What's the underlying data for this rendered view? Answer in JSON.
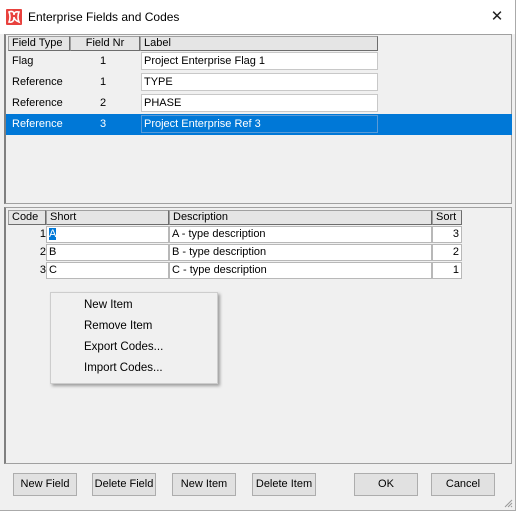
{
  "window": {
    "title": "Enterprise Fields and Codes",
    "icon": "app-logo-icon",
    "close_icon": "close-icon",
    "close_glyph": "✕"
  },
  "fields_table": {
    "columns": [
      "Field Type",
      "Field Nr",
      "Label"
    ],
    "rows": [
      {
        "type": "Flag",
        "nr": "1",
        "label": "Project Enterprise Flag 1",
        "selected": false
      },
      {
        "type": "Reference",
        "nr": "1",
        "label": "TYPE",
        "selected": false
      },
      {
        "type": "Reference",
        "nr": "2",
        "label": "PHASE",
        "selected": false
      },
      {
        "type": "Reference",
        "nr": "3",
        "label": "Project Enterprise Ref 3",
        "selected": true
      }
    ]
  },
  "codes_table": {
    "columns": [
      "Code",
      "Short",
      "Description",
      "Sort"
    ],
    "rows": [
      {
        "code": "1",
        "short": "A",
        "description": "A - type description",
        "sort": "3"
      },
      {
        "code": "2",
        "short": "B",
        "description": "B - type description",
        "sort": "2"
      },
      {
        "code": "3",
        "short": "C",
        "description": "C - type description",
        "sort": "1"
      }
    ]
  },
  "context_menu": {
    "items": [
      "New Item",
      "Remove Item",
      "Export Codes...",
      "Import Codes..."
    ]
  },
  "buttons": {
    "new_field": "New Field",
    "delete_field": "Delete Field",
    "new_item": "New Item",
    "delete_item": "Delete Item",
    "ok": "OK",
    "cancel": "Cancel"
  },
  "colors": {
    "selection": "#0078d7",
    "app_icon": "#e8413d"
  }
}
